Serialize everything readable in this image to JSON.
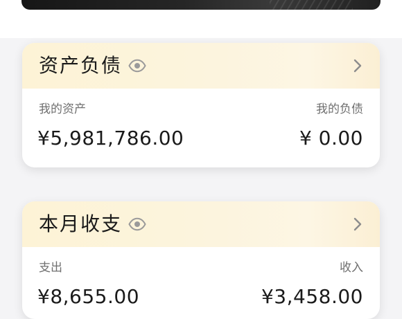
{
  "assets_card": {
    "title": "资产负债",
    "left_label": "我的资产",
    "left_value": "¥5,981,786.00",
    "right_label": "我的负债",
    "right_value": "¥ 0.00"
  },
  "monthly_card": {
    "title": "本月收支",
    "left_label": "支出",
    "left_value": "¥8,655.00",
    "right_label": "收入",
    "right_value": "¥3,458.00"
  },
  "icons": {
    "visibility": "eye-icon",
    "navigate": "chevron-right-icon"
  },
  "colors": {
    "card_header_gradient_start": "#fdf3d6",
    "card_header_gradient_end": "#fbefd4",
    "page_background": "#f4f4f6",
    "icon_gray": "#9a9a9a"
  }
}
